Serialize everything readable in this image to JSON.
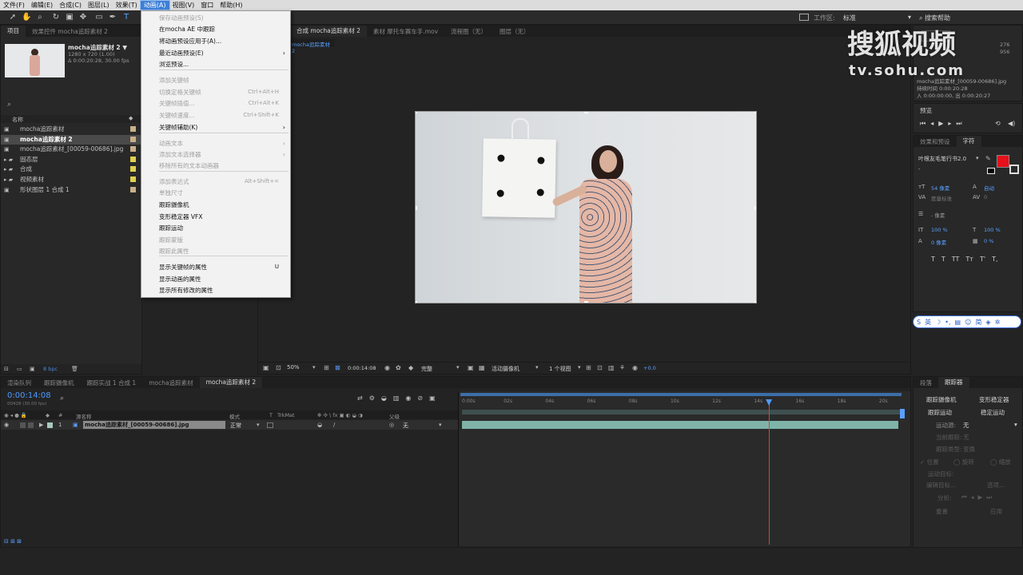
{
  "menubar": {
    "items": [
      "文件(F)",
      "编辑(E)",
      "合成(C)",
      "图层(L)",
      "效果(T)",
      "动画(A)",
      "视图(V)",
      "窗口",
      "帮助(H)"
    ],
    "active_index": 5
  },
  "workspace": {
    "label": "工作区:",
    "value": "标准",
    "search": "搜索帮助"
  },
  "animation_menu": {
    "items": [
      {
        "label": "保存动画预设(S)",
        "disabled": true
      },
      {
        "label": "在mocha AE 中跟踪",
        "disabled": false
      },
      {
        "label": "将动画预设应用于(A)...",
        "disabled": false
      },
      {
        "label": "最近动画预设(E)",
        "disabled": false,
        "submenu": true
      },
      {
        "label": "浏览预设...",
        "disabled": false
      },
      {
        "label": "添加关键帧",
        "disabled": true
      },
      {
        "label": "切换定格关键帧",
        "disabled": true,
        "shortcut": "Ctrl+Alt+H"
      },
      {
        "label": "关键帧插值...",
        "disabled": true,
        "shortcut": "Ctrl+Alt+K"
      },
      {
        "label": "关键帧速度...",
        "disabled": true,
        "shortcut": "Ctrl+Shift+K"
      },
      {
        "label": "关键帧辅助(K)",
        "disabled": false,
        "submenu": true
      },
      {
        "label": "动画文本",
        "disabled": true,
        "submenu": true
      },
      {
        "label": "添加文本选择器",
        "disabled": true,
        "submenu": true
      },
      {
        "label": "移除所有的文本动画器",
        "disabled": true
      },
      {
        "label": "添加表达式",
        "disabled": true,
        "shortcut": "Alt+Shift+="
      },
      {
        "label": "单独尺寸",
        "disabled": true
      },
      {
        "label": "跟踪摄像机",
        "disabled": false
      },
      {
        "label": "变形稳定器 VFX",
        "disabled": false
      },
      {
        "label": "跟踪运动",
        "disabled": false
      },
      {
        "label": "跟踪蒙版",
        "disabled": true
      },
      {
        "label": "跟踪此属性",
        "disabled": true
      },
      {
        "label": "显示关键帧的属性",
        "disabled": false,
        "shortcut": "U"
      },
      {
        "label": "显示动画的属性",
        "disabled": false
      },
      {
        "label": "显示所有修改的属性",
        "disabled": false
      }
    ]
  },
  "project": {
    "tabs": [
      "项目",
      "效果控件 mocha追踪素材 2"
    ],
    "item_name": "mocha追踪素材 2 ▼",
    "item_info1": "1280 x 720 (1.00)",
    "item_info2": "Δ 0:00:20:28, 30.00 fps",
    "search_icon": "⌕",
    "column_name": "名称",
    "rows": [
      {
        "label": "mocha追踪素材",
        "color": "#c8b08a"
      },
      {
        "label": "mocha追踪素材 2",
        "color": "#c8b08a",
        "selected": true
      },
      {
        "label": "mocha追踪素材_[00059-00686].jpg",
        "color": "#c8b08a"
      },
      {
        "label": "固态层",
        "color": "#e0d050",
        "folder": true
      },
      {
        "label": "合成",
        "color": "#e0d050",
        "folder": true
      },
      {
        "label": "视频素材",
        "color": "#e0d050",
        "folder": true
      },
      {
        "label": "形状图层 1 合成 1",
        "color": "#c8b08a"
      }
    ],
    "bpc": "8 bpc"
  },
  "comp": {
    "tabs": [
      "合成 mocha追踪素材 2",
      "素材 摩托车赛车手.mov",
      "流程图（无）",
      "图层（无）"
    ],
    "subtab": "mocha追踪素材 2",
    "zoom": "50%",
    "timecode": "0:00:14:08",
    "resolution": "完整",
    "camera": "活动摄像机",
    "views": "1 个视图",
    "exposure": "+0.0"
  },
  "info": {
    "lines": [
      "mocha追踪素材_[00059-00686].jpg",
      "持续时间 0:00:20:28",
      "入 0:00:00:00, 出 0:00:20:27"
    ],
    "dim": "276",
    "dim2": "956"
  },
  "preview": {
    "title": "预览"
  },
  "character": {
    "tabs": [
      "效果和预设",
      "字符"
    ],
    "font": "叶根友毛笔行书2.0",
    "style": "-",
    "size": "54 像素",
    "leading": "自动",
    "tracking": "度量标准",
    "kern": "0",
    "stroke": "- 像素",
    "vscale": "100 %",
    "hscale": "100 %",
    "baseline": "0 像素",
    "tsume": "0 %",
    "fill_color": "#e8101a",
    "styles": [
      "T",
      "T",
      "TT",
      "Tт",
      "T'",
      "T,"
    ]
  },
  "ime": {
    "label": "英"
  },
  "tracker": {
    "tabs": [
      "段落",
      "跟踪器"
    ],
    "btn1": "跟踪摄像机",
    "btn2": "变形稳定器",
    "btn3": "跟踪运动",
    "btn4": "稳定运动",
    "source_label": "运动源:",
    "source_value": "无",
    "track_label": "当前跟踪:",
    "track_value": "无",
    "type_label": "跟踪类型:",
    "type_value": "变换",
    "checks": [
      "位置",
      "旋转",
      "缩放"
    ],
    "target_label": "运动目标:",
    "edit_target": "编辑目标...",
    "options": "选项...",
    "analyze": "分析:",
    "reset": "重置",
    "apply": "应用"
  },
  "timeline": {
    "tabs": [
      "渲染队列",
      "跟踪摄像机",
      "跟踪实战 1 合成 1",
      "mocha追踪素材",
      "mocha追踪素材 2"
    ],
    "timecode": "0:00:14:08",
    "frame_info": "00428 (30.00 fps)",
    "columns": [
      "#",
      "源名称",
      "模式",
      "T",
      "TrkMat",
      "父级"
    ],
    "layer": {
      "num": "1",
      "name": "mocha追踪素材_[00059-00686].jpg",
      "mode": "正常",
      "parent": "无"
    },
    "ticks": [
      "0:00s",
      "02s",
      "04s",
      "06s",
      "08s",
      "10s",
      "12s",
      "14s",
      "16s",
      "18s",
      "20s"
    ],
    "playhead_fraction": 0.7
  },
  "watermark": {
    "main": "搜狐视频",
    "sub": "tv.sohu.com"
  }
}
